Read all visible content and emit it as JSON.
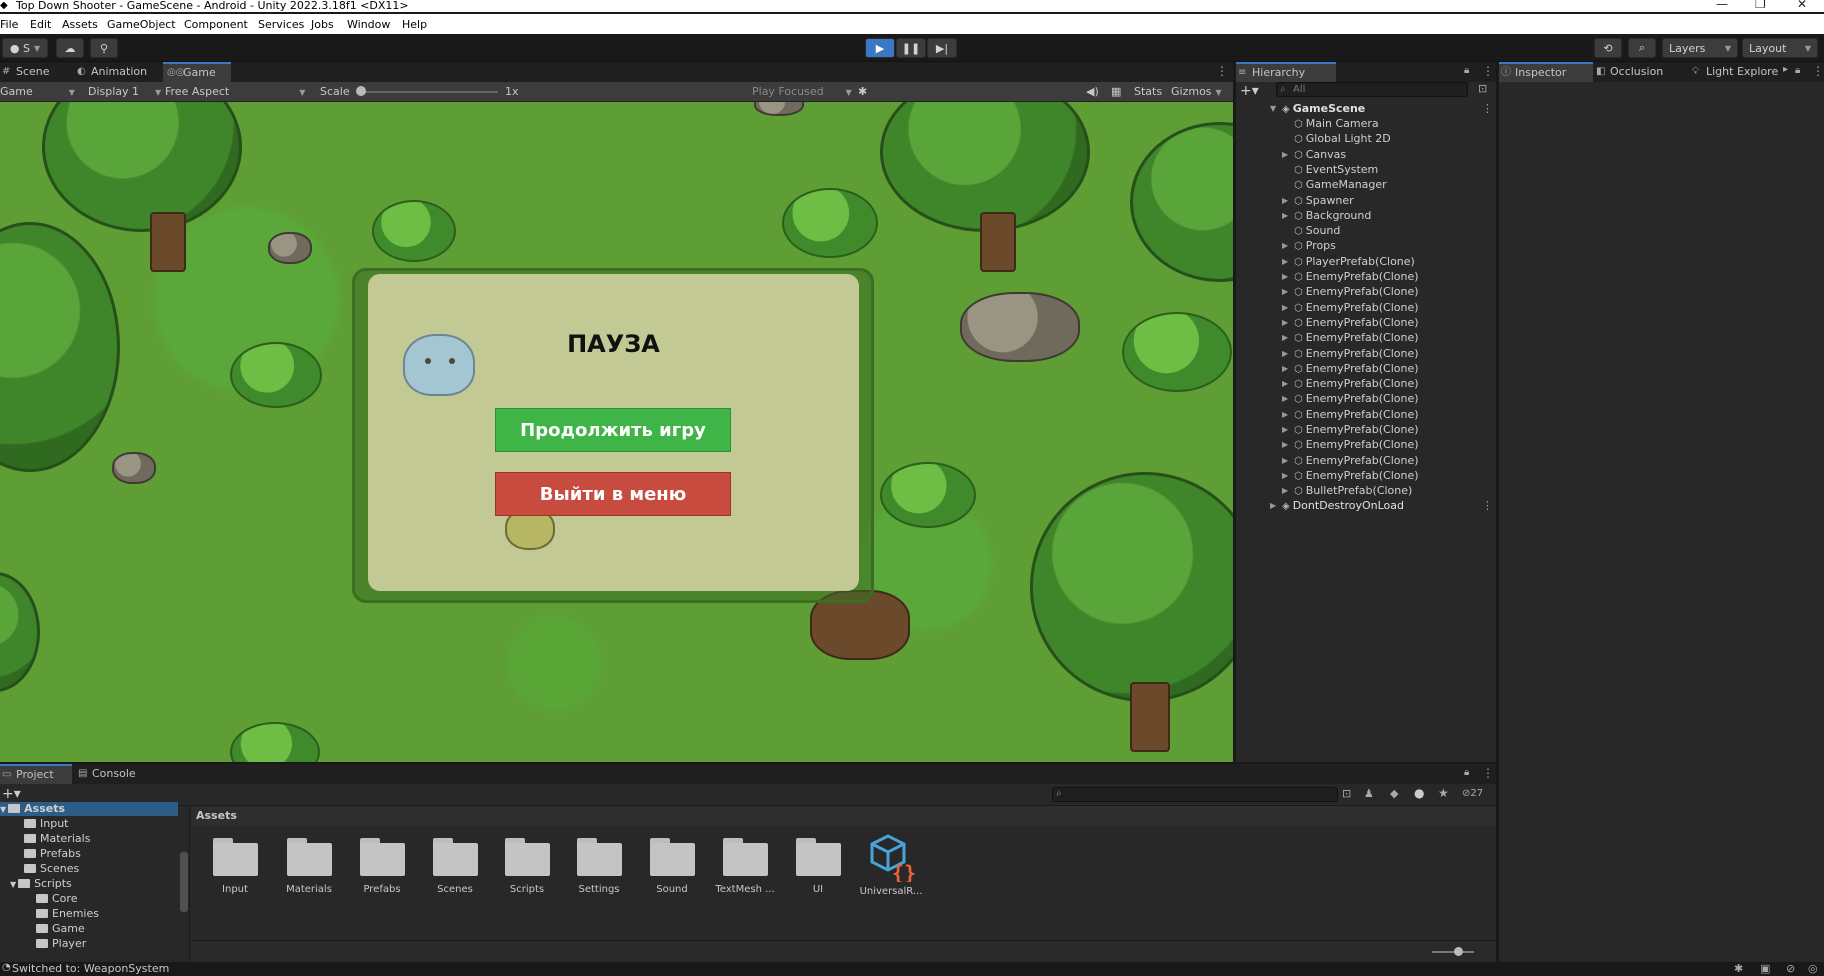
{
  "window": {
    "title": "Top Down Shooter - GameScene - Android - Unity 2022.3.18f1 <DX11>"
  },
  "menu": [
    "File",
    "Edit",
    "Assets",
    "GameObject",
    "Component",
    "Services",
    "Jobs",
    "Window",
    "Help"
  ],
  "toolbar": {
    "account": "S",
    "layers": "Layers",
    "layout": "Layout"
  },
  "center_tabs": [
    "Scene",
    "Animation",
    "Game"
  ],
  "game_bar": {
    "mode": "Game",
    "display": "Display 1",
    "aspect": "Free Aspect",
    "scale_label": "Scale",
    "scale_value": "1x",
    "play_focused": "Play Focused",
    "stats": "Stats",
    "gizmos": "Gizmos"
  },
  "pause_menu": {
    "title": "ПАУЗА",
    "continue": "Продолжить игру",
    "exit": "Выйти в меню"
  },
  "hierarchy": {
    "tab": "Hierarchy",
    "search_placeholder": "All",
    "scene": "GameScene",
    "items": [
      "Main Camera",
      "Global Light 2D",
      "Canvas",
      "EventSystem",
      "GameManager",
      "Spawner",
      "Background",
      "Sound",
      "Props",
      "PlayerPrefab(Clone)",
      "EnemyPrefab(Clone)",
      "EnemyPrefab(Clone)",
      "EnemyPrefab(Clone)",
      "EnemyPrefab(Clone)",
      "EnemyPrefab(Clone)",
      "EnemyPrefab(Clone)",
      "EnemyPrefab(Clone)",
      "EnemyPrefab(Clone)",
      "EnemyPrefab(Clone)",
      "EnemyPrefab(Clone)",
      "EnemyPrefab(Clone)",
      "EnemyPrefab(Clone)",
      "EnemyPrefab(Clone)",
      "EnemyPrefab(Clone)",
      "BulletPrefab(Clone)"
    ],
    "dont_destroy": "DontDestroyOnLoad"
  },
  "inspector_tabs": [
    "Inspector",
    "Occlusion",
    "Light Explore"
  ],
  "bottom_tabs": [
    "Project",
    "Console"
  ],
  "project": {
    "hidden_count": "27",
    "root": "Assets",
    "tree": [
      "Input",
      "Materials",
      "Prefabs",
      "Scenes",
      "Scripts",
      "Core",
      "Enemies",
      "Game",
      "Player"
    ],
    "breadcrumb": "Assets",
    "assets": [
      "Input",
      "Materials",
      "Prefabs",
      "Scenes",
      "Scripts",
      "Settings",
      "Sound",
      "TextMesh ...",
      "UI",
      "UniversalR..."
    ]
  },
  "status": {
    "message": "Switched to: WeaponSystem"
  }
}
